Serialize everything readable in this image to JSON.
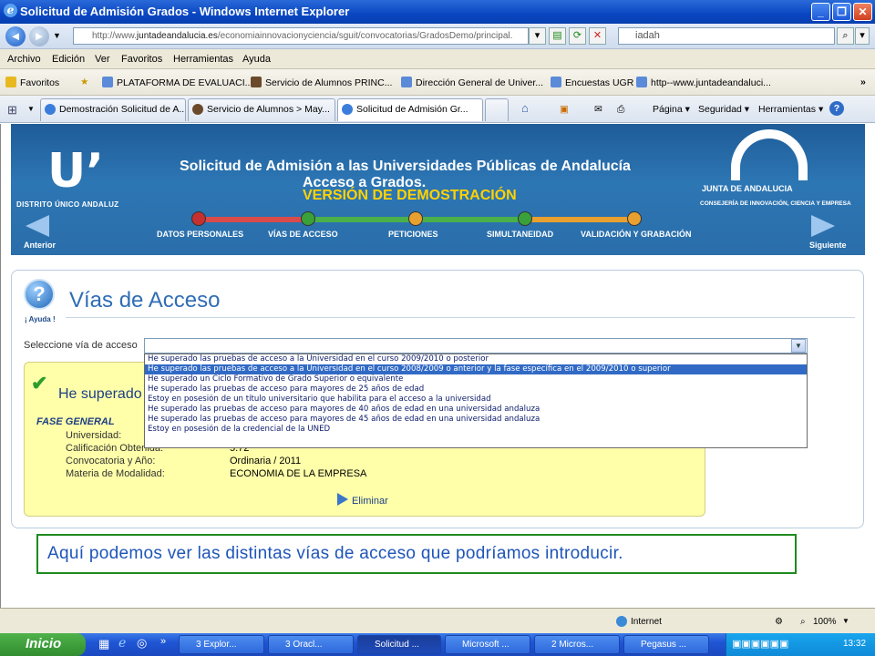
{
  "window": {
    "title": "Solicitud de Admisión Grados - Windows Internet Explorer",
    "min": "_",
    "max": "❐",
    "close": "✕"
  },
  "address": {
    "url_prefix": "http://www.",
    "url_domain": "juntadeandalucia.es",
    "url_rest": "/economiainnovacionyciencia/sguit/convocatorias/GradosDemo/principal.",
    "search_value": "iadah"
  },
  "menu": [
    "Archivo",
    "Edición",
    "Ver",
    "Favoritos",
    "Herramientas",
    "Ayuda"
  ],
  "favorites": {
    "label": "Favoritos",
    "items": [
      "PLATAFORMA DE EVALUACI...",
      "Servicio de Alumnos PRINC...",
      "Dirección General de Univer...",
      "Encuestas UGR",
      "http--www.juntadeandaluci..."
    ],
    "more": "»"
  },
  "tabs": [
    "Demostración Solicitud de A...",
    "Servicio de Alumnos > May...",
    "Solicitud de Admisión Gr..."
  ],
  "tools": {
    "page": "Página",
    "security": "Seguridad",
    "tools": "Herramientas"
  },
  "banner": {
    "title": "Solicitud de Admisión a las Universidades Públicas de Andalucía",
    "subtitle": "Acceso a Grados.",
    "demo": "VERSIÓN DE DEMOSTRACIÓN",
    "logo_du": "DISTRITO ÚNICO ANDALUZ",
    "junta": "JUNTA DE ANDALUCIA",
    "consejeria": "CONSEJERÍA DE INNOVACIÓN, CIENCIA Y EMPRESA",
    "prev": "Anterior",
    "next": "Siguiente",
    "steps": [
      "DATOS PERSONALES",
      "VÍAS DE ACCESO",
      "PETICIONES",
      "SIMULTANEIDAD",
      "VALIDACIÓN Y GRABACIÓN"
    ]
  },
  "main": {
    "help": "¡ Ayuda !",
    "title": "Vías de Acceso",
    "select_label": "Seleccione vía de acceso",
    "options": [
      "He superado las pruebas de acceso a la Universidad en el curso 2009/2010 o posterior",
      "He superado las pruebas de acceso a la Universidad en el curso 2008/2009 o anterior y la fase específica en el 2009/2010 o superior",
      "He superado un Ciclo Formativo de Grado Superior o equivalente",
      "He superado las pruebas de acceso para mayores de 25 años de edad",
      "Estoy en posesión de un título universitario que habilita para el acceso a la universidad",
      "He superado las pruebas de acceso para mayores de 40 años de edad en una universidad andaluza",
      "He superado las pruebas de acceso para mayores de 45 años de edad en una universidad andaluza",
      "Estoy en posesión de la credencial de la UNED"
    ],
    "selected_index": 1,
    "summary_title": "He superado",
    "fase": "FASE GENERAL",
    "fields": [
      {
        "k": "Universidad:",
        "v": ""
      },
      {
        "k": "Calificación Obtenida:",
        "v": "5.72"
      },
      {
        "k": "Convocatoria y Año:",
        "v": "Ordinaria / 2011"
      },
      {
        "k": "Materia de Modalidad:",
        "v": "ECONOMIA DE LA EMPRESA"
      }
    ],
    "delete": "Eliminar"
  },
  "caption": "Aquí podemos ver las distintas vías de acceso que podríamos introducir.",
  "status": {
    "zone": "Internet",
    "zoom": "100%"
  },
  "taskbar": {
    "start": "Inicio",
    "items": [
      "3 Explor...",
      "3 Oracl...",
      "Solicitud ...",
      "Microsoft ...",
      "2 Micros...",
      "Pegasus ..."
    ],
    "clock": "13:32"
  },
  "colors": {
    "accent": "#2f6db5",
    "highlight": "#316ac5",
    "caption_border": "#1e8a1e",
    "summary_bg": "#ffffaa"
  }
}
